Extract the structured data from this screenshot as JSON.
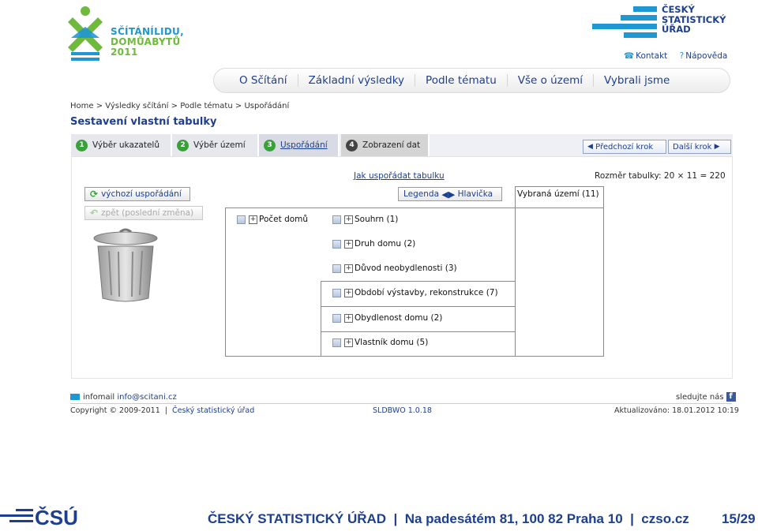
{
  "header": {
    "census_logo_lines": [
      "SČÍTÁNÍLIDU,",
      "DOMŮABYTŮ",
      "2011"
    ],
    "csu_logo_lines": [
      "ČESKÝ",
      "STATISTICKÝ",
      "ÚŘAD"
    ],
    "contact": "Kontakt",
    "help": "Nápověda"
  },
  "nav": {
    "items": [
      "O Sčítání",
      "Základní výsledky",
      "Podle tématu",
      "Vše o území",
      "Vybrali jsme"
    ]
  },
  "breadcrumb": {
    "home": "Home",
    "results": "Výsledky sčítání",
    "by_topic": "Podle tématu",
    "current": "Uspořádání",
    "sep": ">"
  },
  "page_title": "Sestavení vlastní tabulky",
  "wizard": {
    "steps": [
      {
        "num": "1",
        "label": "Výběr ukazatelů"
      },
      {
        "num": "2",
        "label": "Výběr území"
      },
      {
        "num": "3",
        "label": "Uspořádání"
      },
      {
        "num": "4",
        "label": "Zobrazení dat"
      }
    ],
    "prev": "Předchozí krok",
    "next": "Další krok"
  },
  "content": {
    "how_to": "Jak uspořádat tabulku",
    "table_size": "Rozměr tabulky: 20 × 11 = 220",
    "default_btn": "výchozí uspořádání",
    "undo_btn": "zpět (poslední změna)",
    "legend_btn": "Legenda",
    "header_btn": "Hlavička",
    "row_field": "Počet domů",
    "selected_area": "Vybraná území (11)",
    "fields": [
      "Souhrn (1)",
      "Druh domu (2)",
      "Důvod neobydlenosti (3)",
      "Období výstavby, rekonstrukce (7)",
      "Obydlenost domu (2)",
      "Vlastník domu (5)"
    ]
  },
  "footer": {
    "infomail_label": "infomail",
    "email": "info@scitani.cz",
    "follow": "sledujte nás",
    "copyright": "Copyright © 2009-2011",
    "org_link": "Český statistický úřad",
    "version": "SLDBWO 1.0.18",
    "updated": "Aktualizováno: 18.01.2012 10:19"
  },
  "slide": {
    "footer_text": "ČESKÝ STATISTICKÝ ÚŘAD  |  Na padesátém 81, 100 82 Praha 10  |  czso.cz",
    "page": "15/29",
    "logo_text": "ČSÚ"
  },
  "colors": {
    "brand_blue": "#1d3f8f",
    "census_blue": "#1e97d3",
    "census_green": "#6fba3c",
    "step_green": "#3aa13a"
  }
}
